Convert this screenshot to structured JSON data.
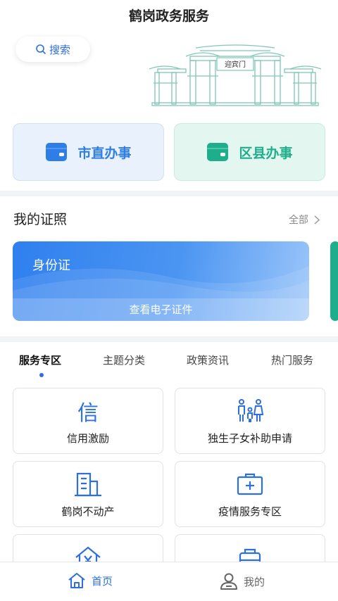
{
  "header": {
    "title": "鹤岗政务服务",
    "search_label": "搜索",
    "gate_sign": "迎宾门"
  },
  "quick_actions": [
    {
      "label": "市直办事",
      "icon": "folder-icon",
      "color": "#2f7de6"
    },
    {
      "label": "区县办事",
      "icon": "folder-icon",
      "color": "#1fae8c"
    }
  ],
  "certificates": {
    "title": "我的证照",
    "all_label": "全部",
    "card": {
      "name": "身份证",
      "action": "查看电子证件"
    }
  },
  "tabs": [
    {
      "label": "服务专区",
      "active": true
    },
    {
      "label": "主题分类",
      "active": false
    },
    {
      "label": "政策资讯",
      "active": false
    },
    {
      "label": "热门服务",
      "active": false
    }
  ],
  "services": [
    {
      "label": "信用激励",
      "icon": "credit-char-icon",
      "glyph": "信"
    },
    {
      "label": "独生子女补助申请",
      "icon": "family-icon"
    },
    {
      "label": "鹤岗不动产",
      "icon": "building-icon"
    },
    {
      "label": "疫情服务专区",
      "icon": "medical-kit-icon"
    },
    {
      "label": "",
      "icon": "house-yuan-icon"
    },
    {
      "label": "",
      "icon": "bag-icon"
    }
  ],
  "bottom_nav": [
    {
      "label": "首页",
      "icon": "home-icon",
      "active": true
    },
    {
      "label": "我的",
      "icon": "user-icon",
      "active": false
    }
  ],
  "colors": {
    "primary": "#2d6fe0",
    "green": "#1fae8c"
  }
}
